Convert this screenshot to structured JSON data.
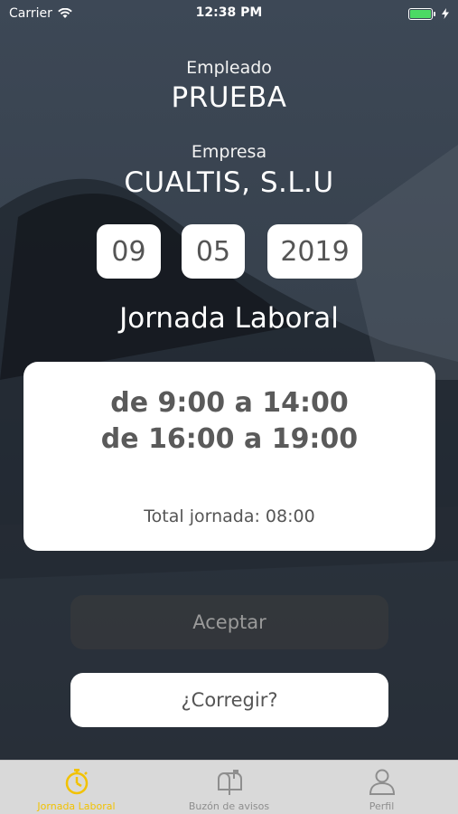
{
  "status_bar": {
    "carrier": "Carrier",
    "time": "12:38 PM"
  },
  "employee": {
    "label": "Empleado",
    "value": "PRUEBA"
  },
  "company": {
    "label": "Empresa",
    "value": "CUALTIS, S.L.U"
  },
  "date": {
    "day": "09",
    "month": "05",
    "year": "2019"
  },
  "section_title": "Jornada Laboral",
  "schedule": {
    "line1": "de 9:00 a 14:00",
    "line2": "de 16:00 a 19:00",
    "total": "Total jornada: 08:00"
  },
  "buttons": {
    "accept": "Aceptar",
    "correct": "¿Corregir?"
  },
  "tabs": [
    {
      "label": "Jornada Laboral",
      "icon": "stopwatch-icon",
      "active": true
    },
    {
      "label": "Buzón de avisos",
      "icon": "mailbox-icon",
      "active": false
    },
    {
      "label": "Perfil",
      "icon": "user-icon",
      "active": false
    }
  ],
  "colors": {
    "accent": "#f2c200",
    "battery": "#4cd964"
  }
}
